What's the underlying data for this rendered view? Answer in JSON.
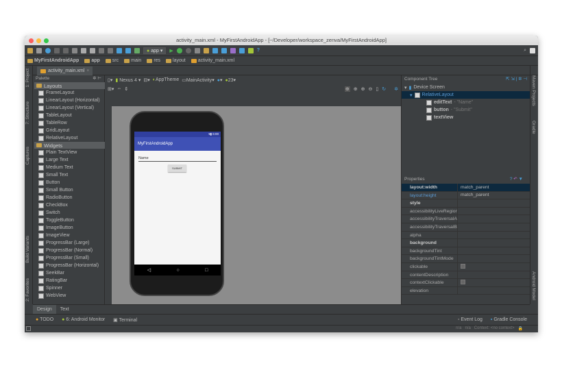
{
  "window": {
    "title": "activity_main.xml - MyFirstAndroidApp - [~/Developer/workspace_zenva/MyFirstAndroidApp]"
  },
  "toolbar": {
    "run_config": "app",
    "help": "?"
  },
  "breadcrumb": [
    "MyFirstAndroidApp",
    "app",
    "src",
    "main",
    "res",
    "layout",
    "activity_main.xml"
  ],
  "editor_tab": "activity_main.xml",
  "left_strip": [
    "1: Project",
    "7: Structure",
    "Captures",
    "Build Variants",
    "2: Favorites"
  ],
  "right_strip": [
    "Maven Projects",
    "Gradle",
    "Android Model"
  ],
  "palette": {
    "title": "Palette",
    "groups": [
      {
        "name": "Layouts",
        "items": [
          "FrameLayout",
          "LinearLayout (Horizontal)",
          "LinearLayout (Vertical)",
          "TableLayout",
          "TableRow",
          "GridLayout",
          "RelativeLayout"
        ]
      },
      {
        "name": "Widgets",
        "items": [
          "Plain TextView",
          "Large Text",
          "Medium Text",
          "Small Text",
          "Button",
          "Small Button",
          "RadioButton",
          "CheckBox",
          "Switch",
          "ToggleButton",
          "ImageButton",
          "ImageView",
          "ProgressBar (Large)",
          "ProgressBar (Normal)",
          "ProgressBar (Small)",
          "ProgressBar (Horizontal)",
          "SeekBar",
          "RatingBar",
          "Spinner",
          "WebView"
        ]
      }
    ]
  },
  "design_toolbar": {
    "device": "Nexus 4",
    "theme": "AppTheme",
    "activity": "MainActivity",
    "api": "23"
  },
  "preview": {
    "time": "6:00",
    "app_title": "MyFirstAndroidApp",
    "edit_hint": "Name",
    "button": "SUBMIT"
  },
  "component_tree": {
    "title": "Component Tree",
    "root": "Device Screen",
    "layout": "RelativeLayout",
    "children": [
      {
        "id": "editText",
        "text": "- \"Name\""
      },
      {
        "id": "button",
        "text": "- \"Submit\""
      },
      {
        "id": "textView",
        "text": ""
      }
    ]
  },
  "properties": {
    "title": "Properties",
    "rows": [
      {
        "k": "layout:width",
        "v": "match_parent"
      },
      {
        "k": "layout:height",
        "v": "match_parent"
      },
      {
        "k": "style",
        "v": ""
      },
      {
        "k": "accessibilityLiveRegion",
        "v": ""
      },
      {
        "k": "accessibilityTraversalAfter",
        "v": ""
      },
      {
        "k": "accessibilityTraversalBefore",
        "v": ""
      },
      {
        "k": "alpha",
        "v": ""
      },
      {
        "k": "background",
        "v": ""
      },
      {
        "k": "backgroundTint",
        "v": ""
      },
      {
        "k": "backgroundTintMode",
        "v": ""
      },
      {
        "k": "clickable",
        "v": ""
      },
      {
        "k": "contentDescription",
        "v": ""
      },
      {
        "k": "contextClickable",
        "v": ""
      },
      {
        "k": "elevation",
        "v": ""
      }
    ]
  },
  "bottom_tabs": [
    "Design",
    "Text"
  ],
  "tool_windows": {
    "todo": "TODO",
    "monitor": "6: Android Monitor",
    "terminal": "Terminal",
    "event_log": "Event Log",
    "gradle": "Gradle Console"
  },
  "statusbar": {
    "a": "n/a",
    "b": "n/a",
    "context": "Context: <no context>"
  }
}
